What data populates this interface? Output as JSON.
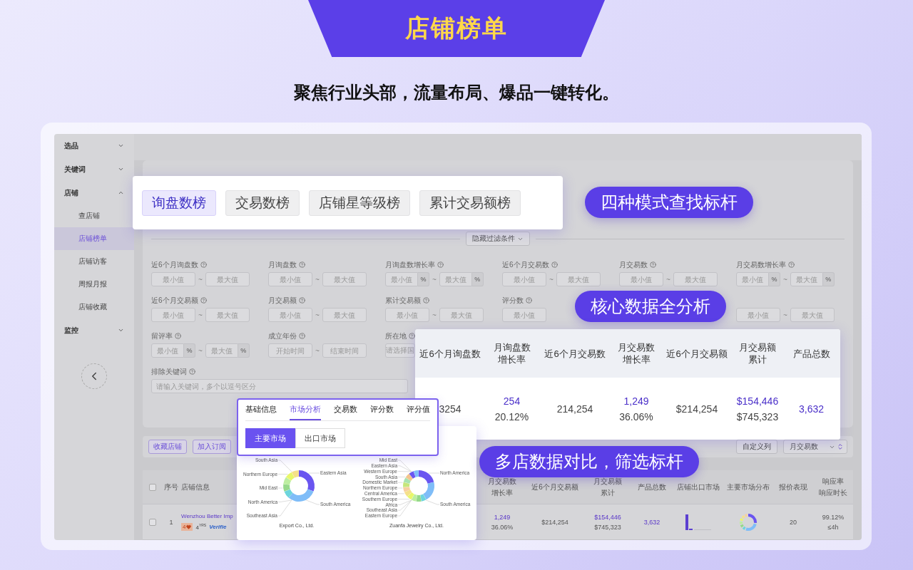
{
  "banner": {
    "title": "店铺榜单",
    "subtitle": "聚焦行业头部，流量布局、爆品一键转化。"
  },
  "sidebar": {
    "items": [
      {
        "label": "选品",
        "expanded": false
      },
      {
        "label": "关键词",
        "expanded": false
      },
      {
        "label": "店铺",
        "expanded": true,
        "children": [
          {
            "label": "查店铺",
            "selected": false
          },
          {
            "label": "店铺榜单",
            "selected": true
          },
          {
            "label": "店铺访客",
            "selected": false
          },
          {
            "label": "周报月报",
            "selected": false
          },
          {
            "label": "店铺收藏",
            "selected": false
          }
        ]
      },
      {
        "label": "监控",
        "expanded": false
      }
    ]
  },
  "filters": {
    "toggle": "隐藏过滤条件",
    "rows": [
      [
        {
          "kind": "range",
          "label": "近6个月询盘数",
          "min": {
            "placeholder": "最小值"
          },
          "separator": "~",
          "max": {
            "placeholder": "最大值"
          }
        },
        {
          "kind": "range",
          "label": "月询盘数",
          "min": {
            "placeholder": "最小值"
          },
          "separator": "~",
          "max": {
            "placeholder": "最大值"
          }
        },
        {
          "kind": "range",
          "label": "月询盘数增长率",
          "min": {
            "placeholder": "最小值"
          },
          "separator": "~",
          "max": {
            "placeholder": "最大值"
          },
          "unit": "%"
        },
        {
          "kind": "range",
          "label": "近6个月交易数",
          "min": {
            "placeholder": "最小值"
          },
          "separator": "~",
          "max": {
            "placeholder": "最大值"
          }
        },
        {
          "kind": "range",
          "label": "月交易数",
          "min": {
            "placeholder": "最小值"
          },
          "separator": "~",
          "max": {
            "placeholder": "最大值"
          }
        },
        {
          "kind": "range",
          "label": "月交易数增长率",
          "min": {
            "placeholder": "最小值"
          },
          "separator": "~",
          "max": {
            "placeholder": "最大值"
          },
          "unit": "%"
        }
      ],
      [
        {
          "kind": "range",
          "label": "近6个月交易额",
          "min": {
            "placeholder": "最小值"
          },
          "separator": "~",
          "max": {
            "placeholder": "最大值"
          }
        },
        {
          "kind": "range",
          "label": "月交易额",
          "min": {
            "placeholder": "最小值"
          },
          "separator": "~",
          "max": {
            "placeholder": "最大值"
          }
        },
        {
          "kind": "range",
          "label": "累计交易额",
          "min": {
            "placeholder": "最小值"
          },
          "separator": "~",
          "max": {
            "placeholder": "最大值"
          }
        },
        {
          "kind": "range",
          "label": "评分数",
          "min": {
            "placeholder": "最小值"
          }
        },
        "",
        {
          "kind": "range",
          "min": {
            "placeholder": "最小值"
          },
          "separator": "~",
          "max": {
            "placeholder": "最大值"
          }
        }
      ],
      [
        {
          "kind": "range",
          "label": "留评率",
          "min": {
            "placeholder": "最小值"
          },
          "separator": "~",
          "max": {
            "placeholder": "最大值"
          },
          "unit": "%"
        },
        {
          "kind": "range",
          "label": "成立年份",
          "min": {
            "placeholder": "开始时间"
          },
          "separator": "~",
          "max": {
            "placeholder": "结束时间"
          }
        },
        {
          "kind": "select",
          "label": "所在地",
          "placeholder": "请选择国"
        }
      ],
      [
        {
          "kind": "text",
          "label": "排除关键词",
          "placeholder": "请输入关键词，多个以逗号区分"
        }
      ]
    ]
  },
  "actions": {
    "left": [
      "收藏店铺",
      "加入订阅"
    ],
    "custom": "自定义列",
    "sort": "月交易数"
  },
  "table": {
    "all_checked": false,
    "columns_left": [
      "序号",
      "店铺信息"
    ],
    "columns_right": [
      [
        "月交易数",
        "增长率"
      ],
      [
        "近6个月交易额"
      ],
      [
        "月交易额",
        "累计"
      ],
      [
        "产品总数"
      ],
      [
        "店铺出口市场"
      ],
      [
        "主要市场分布"
      ],
      [
        "报价表现"
      ],
      [
        "响应率",
        "响应时长"
      ]
    ],
    "rows": [
      {
        "checked": false,
        "index": "1",
        "shop": "Wenzhou Better Imp",
        "badge": "4",
        "years": "4$^{YRS}$",
        "verified": "Verifie",
        "cells": [
          {
            "kind": "lines",
            "lines": [
              {
                "text": "1,249",
                "emphasis": true
              },
              {
                "text": "36.06%",
                "emphasis": false
              }
            ]
          },
          {
            "kind": "lines",
            "lines": [
              {
                "text": "$214,254",
                "emphasis": false
              }
            ]
          },
          {
            "kind": "lines",
            "lines": [
              {
                "text": "$154,446",
                "emphasis": true
              },
              {
                "text": "$745,323",
                "emphasis": false
              }
            ]
          },
          {
            "kind": "lines",
            "lines": [
              {
                "text": "3,632",
                "emphasis": true
              }
            ]
          },
          {
            "kind": "bars"
          },
          {
            "kind": "donut"
          },
          {
            "kind": "lines",
            "lines": [
              {
                "text": "20",
                "emphasis": false
              }
            ]
          },
          {
            "kind": "lines",
            "lines": [
              {
                "text": "99.12%",
                "emphasis": false
              },
              {
                "text": "≤4h",
                "emphasis": false
              }
            ]
          }
        ]
      }
    ]
  },
  "mode_tabs": [
    {
      "label": "询盘数榜",
      "selected": true
    },
    {
      "label": "交易数榜",
      "selected": false
    },
    {
      "label": "店铺星等级榜",
      "selected": false
    },
    {
      "label": "累计交易额榜",
      "selected": false
    }
  ],
  "mode_callout": "四种模式查找标杆",
  "data_callout": "核心数据全分析",
  "data_card": {
    "columns": [
      [
        "近6个月询盘数"
      ],
      [
        "月询盘数",
        "增长率"
      ],
      [
        "近6个月交易数"
      ],
      [
        "月交易数",
        "增长率"
      ],
      [
        "近6个月交易额"
      ],
      [
        "月交易额",
        "累计"
      ],
      [
        "产品总数"
      ]
    ],
    "row": [
      {
        "lines": [
          {
            "text": "3254",
            "emphasis": false
          }
        ]
      },
      {
        "lines": [
          {
            "text": "254",
            "emphasis": true
          },
          {
            "text": "20.12%",
            "emphasis": false
          }
        ]
      },
      {
        "lines": [
          {
            "text": "214,254",
            "emphasis": false
          }
        ]
      },
      {
        "lines": [
          {
            "text": "1,249",
            "emphasis": true
          },
          {
            "text": "36.06%",
            "emphasis": false
          }
        ]
      },
      {
        "lines": [
          {
            "text": "$214,254",
            "emphasis": false
          }
        ]
      },
      {
        "lines": [
          {
            "text": "$154,446",
            "emphasis": true
          },
          {
            "text": "$745,323",
            "emphasis": false
          }
        ]
      },
      {
        "lines": [
          {
            "text": "3,632",
            "emphasis": true
          }
        ]
      }
    ]
  },
  "detail": {
    "tabs": [
      {
        "label": "基础信息",
        "selected": false
      },
      {
        "label": "市场分析",
        "selected": true
      },
      {
        "label": "交易数",
        "selected": false
      },
      {
        "label": "评分数",
        "selected": false
      },
      {
        "label": "评分值",
        "selected": false
      }
    ],
    "markets": [
      {
        "label": "主要市场",
        "selected": true
      },
      {
        "label": "出口市场",
        "selected": false
      }
    ]
  },
  "donuts": [
    {
      "left_labels": [
        "South Asia",
        "Northern Europe",
        "Mid East",
        "North America",
        "Southeast Asia"
      ],
      "right_labels": [
        "Eastern Asia",
        "South America"
      ],
      "caption": "Export Co., Ltd."
    },
    {
      "left_labels": [
        "Mid East",
        "Eastern Asia",
        "Western Europe",
        "South Asia",
        "Domestic Market",
        "Northern Europe",
        "Central America",
        "Southern Europe",
        "Africa",
        "Southeast Asia",
        "Eastern Europe"
      ],
      "right_labels": [
        "North America",
        "South America"
      ],
      "caption": "Zuanfa Jewelry Co., Ltd."
    }
  ],
  "compare_callout": "多店数据对比，筛选标杆"
}
